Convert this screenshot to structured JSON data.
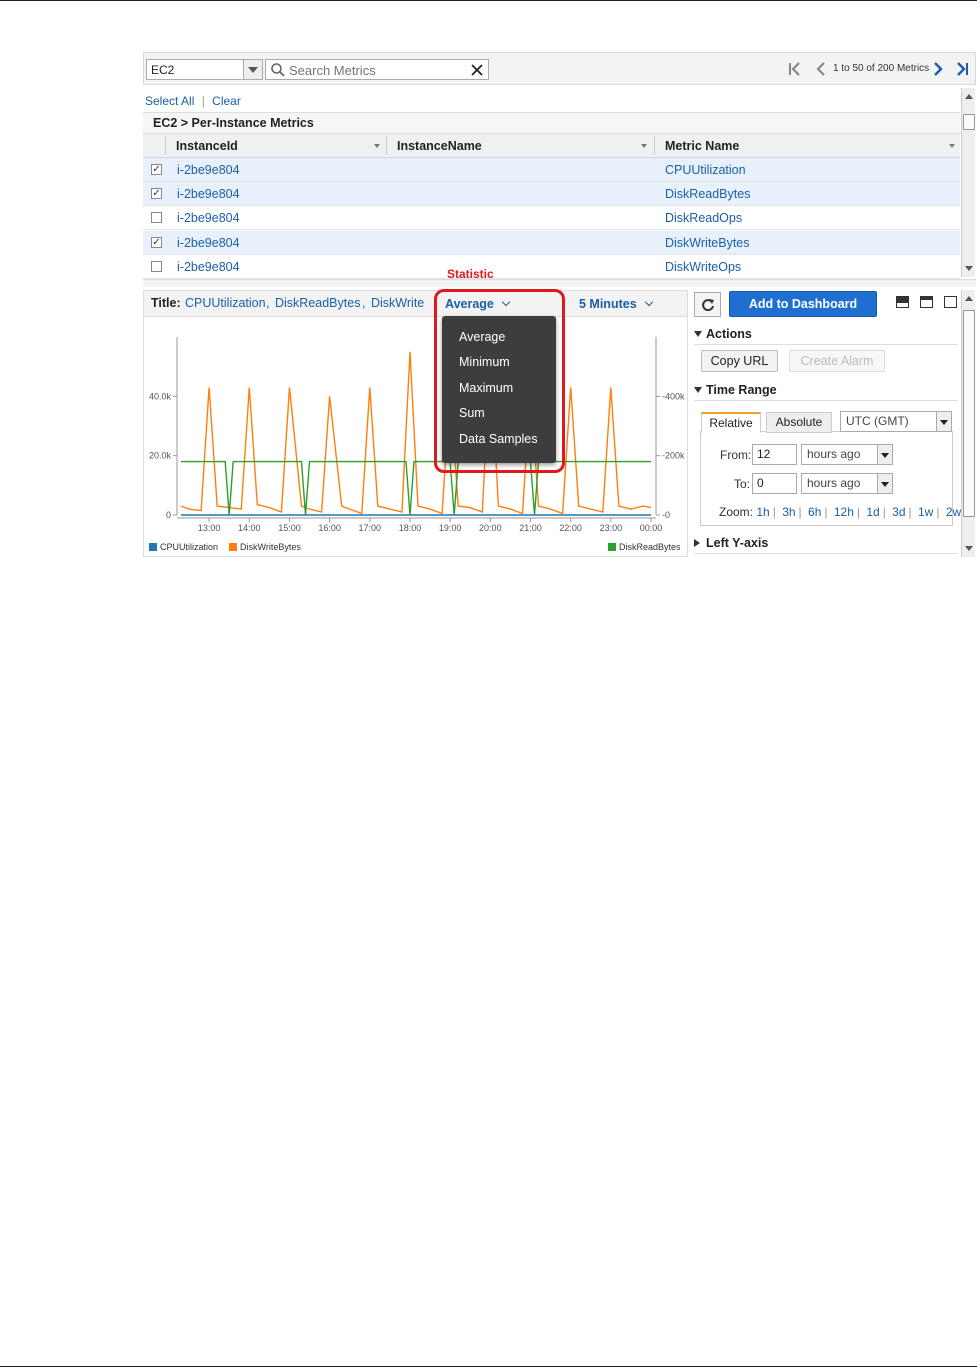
{
  "namespace_select": {
    "value": "EC2"
  },
  "search": {
    "placeholder": "Search Metrics"
  },
  "pager": {
    "text": "1 to 50 of 200 Metrics"
  },
  "selection": {
    "select_all": "Select All",
    "clear": "Clear",
    "separator": "|"
  },
  "breadcrumb": "EC2 > Per-Instance Metrics",
  "grid": {
    "columns": [
      "InstanceId",
      "InstanceName",
      "Metric Name"
    ],
    "rows": [
      {
        "checked": true,
        "check_mark": "✓",
        "instance_id": "i-2be9e804",
        "instance_name": "",
        "metric": "CPUUtilization"
      },
      {
        "checked": true,
        "check_mark": "✓",
        "instance_id": "i-2be9e804",
        "instance_name": "",
        "metric": "DiskReadBytes"
      },
      {
        "checked": false,
        "check_mark": "",
        "instance_id": "i-2be9e804",
        "instance_name": "",
        "metric": "DiskReadOps"
      },
      {
        "checked": true,
        "check_mark": "✓",
        "instance_id": "i-2be9e804",
        "instance_name": "",
        "metric": "DiskWriteBytes"
      },
      {
        "checked": false,
        "check_mark": "",
        "instance_id": "i-2be9e804",
        "instance_name": "",
        "metric": "DiskWriteOps"
      }
    ]
  },
  "chart_header": {
    "title_label": "Title:",
    "title_items": [
      "CPUUtilization",
      ",",
      "DiskReadBytes",
      ",",
      "DiskWrite"
    ],
    "statistic": "Average",
    "period": "5 Minutes"
  },
  "annotation": {
    "label": "Statistic",
    "color": "#e0191f"
  },
  "statistic_menu": [
    "Average",
    "Minimum",
    "Maximum",
    "Sum",
    "Data Samples"
  ],
  "right_panel": {
    "add_to_dashboard": "Add to Dashboard",
    "actions_title": "Actions",
    "copy_url": "Copy URL",
    "create_alarm": "Create Alarm",
    "time_range_title": "Time Range",
    "tabs": [
      "Relative",
      "Absolute"
    ],
    "timezone": "UTC (GMT)",
    "from_label": "From:",
    "from_value": "12",
    "from_unit": "hours ago",
    "to_label": "To:",
    "to_value": "0",
    "to_unit": "hours ago",
    "zoom_label": "Zoom:",
    "zoom_options": [
      "1h",
      "3h",
      "6h",
      "12h",
      "1d",
      "3d",
      "1w",
      "2w"
    ],
    "left_y_axis": "Left Y-axis"
  },
  "icons": {
    "search": "magnifier-icon",
    "clear": "x-icon",
    "first": "first-page-icon",
    "prev": "prev-page-icon",
    "next": "next-page-icon",
    "last": "last-page-icon",
    "refresh": "refresh-icon"
  },
  "colors": {
    "link": "#1a5fa8",
    "primary_button": "#1f6fd0",
    "active_tab": "#f0a12c",
    "menu_bg": "#3d3d3d"
  },
  "chart_data": {
    "type": "line",
    "x_ticks": [
      "13:00",
      "14:00",
      "15:00",
      "16:00",
      "17:00",
      "18:00",
      "19:00",
      "20:00",
      "21:00",
      "22:00",
      "23:00",
      "00:00"
    ],
    "left_y_ticks": [
      "0",
      "20.0k",
      "40.0k"
    ],
    "right_y_ticks": [
      "0",
      "200k",
      "400k"
    ],
    "left_ylim": [
      0,
      60000
    ],
    "right_ylim": [
      0,
      600000
    ],
    "legend": [
      "CPUUtilization",
      "DiskWriteBytes",
      "DiskReadBytes"
    ],
    "series": [
      {
        "name": "CPUUtilization",
        "axis": "left",
        "color": "#1f77b4",
        "x": [
          12.3,
          24.0
        ],
        "values": [
          0,
          0
        ]
      },
      {
        "name": "DiskWriteBytes",
        "axis": "left",
        "color": "#ff7f0e",
        "x": [
          12.3,
          12.5,
          12.8,
          13.0,
          13.2,
          13.5,
          13.8,
          14.0,
          14.2,
          14.5,
          14.8,
          15.0,
          15.3,
          15.5,
          15.8,
          16.0,
          16.3,
          16.5,
          16.8,
          17.0,
          17.2,
          17.5,
          17.8,
          18.0,
          18.2,
          18.5,
          18.8,
          19.0,
          19.2,
          19.5,
          19.8,
          20.0,
          20.2,
          20.5,
          20.8,
          21.0,
          21.2,
          21.5,
          21.8,
          22.0,
          22.2,
          22.5,
          22.8,
          23.0,
          23.2,
          23.5,
          23.8,
          24.0
        ],
        "values": [
          3000,
          2000,
          1500,
          43000,
          3000,
          2500,
          2000,
          43000,
          3500,
          2500,
          1000,
          43000,
          3000,
          2000,
          1000,
          40000,
          3000,
          2000,
          500,
          43000,
          3000,
          2000,
          1000,
          55000,
          3000,
          2000,
          500,
          43000,
          3000,
          2500,
          1000,
          54000,
          3000,
          2000,
          500,
          43000,
          3000,
          2000,
          500,
          43000,
          3000,
          2000,
          1000,
          43000,
          3000,
          2000,
          3000,
          2500
        ]
      },
      {
        "name": "DiskReadBytes",
        "axis": "right",
        "color": "#2ca02c",
        "x": [
          12.3,
          13.4,
          13.5,
          13.6,
          15.3,
          15.4,
          15.5,
          17.9,
          18.0,
          18.1,
          19.0,
          19.1,
          19.2,
          21.0,
          21.1,
          21.2,
          24.0
        ],
        "values": [
          180000,
          180000,
          0,
          180000,
          180000,
          0,
          180000,
          180000,
          0,
          180000,
          180000,
          0,
          180000,
          180000,
          0,
          180000,
          180000
        ]
      }
    ]
  }
}
